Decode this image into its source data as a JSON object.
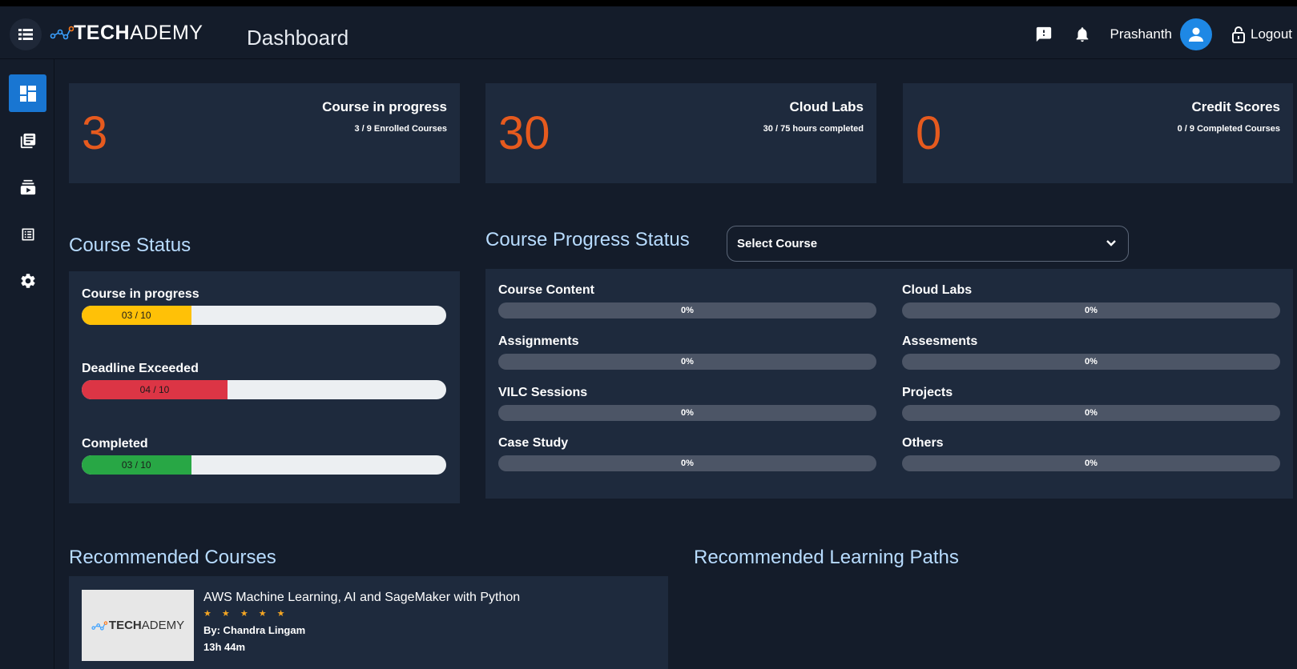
{
  "app": {
    "logo_bold": "TECH",
    "logo_light": "ADEMY",
    "page_title": "Dashboard",
    "user_name": "Prashanth",
    "logout_label": "Logout"
  },
  "sidebar": {
    "items": [
      {
        "icon": "dashboard-icon",
        "active": true
      },
      {
        "icon": "library-books-icon",
        "active": false
      },
      {
        "icon": "subscriptions-icon",
        "active": false
      },
      {
        "icon": "list-alt-icon",
        "active": false
      },
      {
        "icon": "gear-icon",
        "active": false
      }
    ]
  },
  "stats": [
    {
      "number": "3",
      "title": "Course in progress",
      "subtitle": "3 / 9 Enrolled Courses"
    },
    {
      "number": "30",
      "title": "Cloud Labs",
      "subtitle": "30 / 75 hours completed"
    },
    {
      "number": "0",
      "title": "Credit Scores",
      "subtitle": "0 / 9 Completed Courses"
    }
  ],
  "course_status": {
    "title": "Course Status",
    "bars": [
      {
        "label": "Course in progress",
        "text": "03 / 10",
        "value": 3,
        "max": 10,
        "color": "#ffc107"
      },
      {
        "label": "Deadline Exceeded",
        "text": "04 / 10",
        "value": 4,
        "max": 10,
        "color": "#dc3545"
      },
      {
        "label": "Completed",
        "text": "03 / 10",
        "value": 3,
        "max": 10,
        "color": "#28a745"
      }
    ]
  },
  "progress_status": {
    "title": "Course Progress Status",
    "select_label": "Select Course",
    "items": [
      {
        "label": "Course Content",
        "value": "0%"
      },
      {
        "label": "Cloud Labs",
        "value": "0%"
      },
      {
        "label": "Assignments",
        "value": "0%"
      },
      {
        "label": "Assesments",
        "value": "0%"
      },
      {
        "label": "VILC Sessions",
        "value": "0%"
      },
      {
        "label": "Projects",
        "value": "0%"
      },
      {
        "label": "Case Study",
        "value": "0%"
      },
      {
        "label": "Others",
        "value": "0%"
      }
    ]
  },
  "recommended_courses": {
    "title": "Recommended Courses",
    "items": [
      {
        "thumb_bold": "TECH",
        "thumb_light": "ADEMY",
        "title": "AWS Machine Learning, AI and SageMaker with Python",
        "stars": "★ ★ ★ ★ ★",
        "rating": 4.5,
        "author": "By: Chandra Lingam",
        "duration": "13h 44m"
      }
    ]
  },
  "recommended_paths": {
    "title": "Recommended Learning Paths"
  },
  "colors": {
    "accent_orange": "#e65a1e",
    "primary_blue": "#1976d2",
    "section_title": "#b8dcff",
    "card_bg": "#1e2a3d",
    "page_bg": "#141c2a"
  }
}
